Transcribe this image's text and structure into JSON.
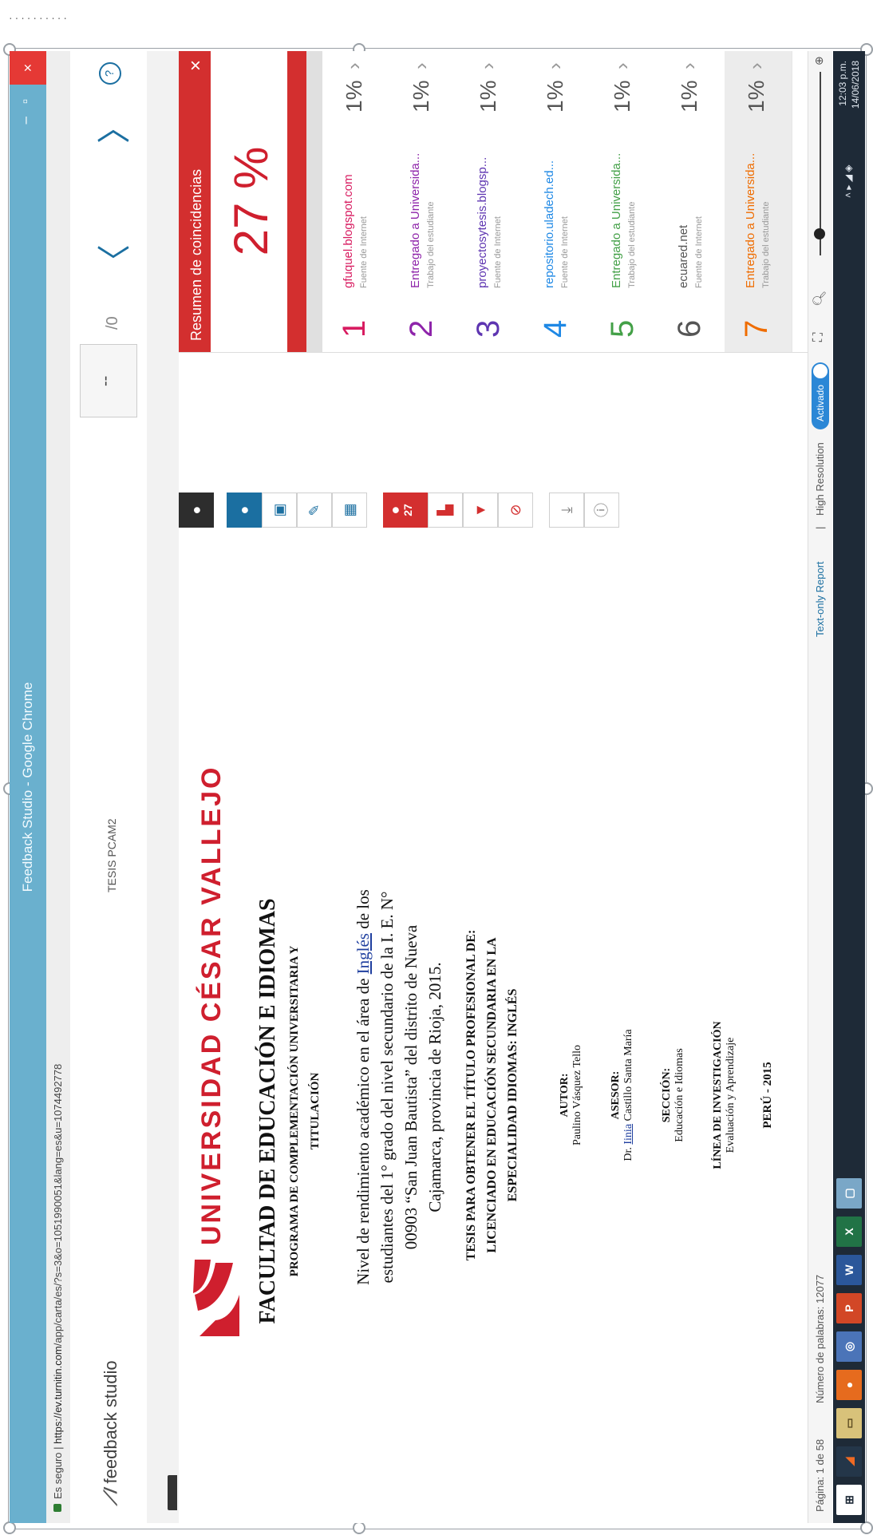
{
  "image_label": "..........",
  "browser": {
    "window_title": "Feedback Studio - Google Chrome",
    "secure_label": "Es seguro",
    "url_host": "https://ev.turnitin.com",
    "url_path": "/app/carta/es/?s=3&o=1051990051&lang=es&u=1074492778"
  },
  "app": {
    "logo_text": "feedback studio",
    "document_title": "TESIS PCAM2",
    "page_field": "--",
    "page_total": "/0",
    "help": "?"
  },
  "document": {
    "university": "UNIVERSIDAD CÉSAR VALLEJO",
    "faculty": "FACULTAD DE EDUCACIÓN E IDIOMAS",
    "program_line1": "PROGRAMA DE COMPLEMENTACIÓN UNIVERSITARIA Y",
    "program_line2": "TITULACIÓN",
    "thesis_line1_pre": "Nivel de rendimiento académico en el área de ",
    "thesis_line1_hl": "Inglés",
    "thesis_line1_post": " de los",
    "thesis_line2": "estudiantes del 1° grado del nivel secundario de la I. E. N°",
    "thesis_line3": "00903 “San Juan Bautista” del distrito de Nueva",
    "thesis_line4": "Cajamarca, provincia de Rioja, 2015.",
    "tesis_line1": "TESIS PARA OBTENER EL TÍTULO PROFESIONAL DE:",
    "tesis_line2": "LICENCIADO EN EDUCACIÓN SECUNDARIA EN LA",
    "tesis_line3": "ESPECIALIDAD IDIOMAS: INGLÉS",
    "autor_label": "AUTOR:",
    "autor": "Paulino Vásquez Tello",
    "asesor_label": "ASESOR:",
    "asesor_pre": "Dr. ",
    "asesor_hl": "Iinia",
    "asesor_post": " Castillo Santa María",
    "seccion_label": "SECCIÓN:",
    "seccion": "Educación e Idiomas",
    "linea_label": "LÍNEA DE INVESTIGACIÓN",
    "linea": "Evaluación y Aprendizaje",
    "peru": "PERÚ - 2015"
  },
  "toolbar": {
    "match_count": "27"
  },
  "panel": {
    "title": "Resumen de coincidencias",
    "close": "×",
    "overall": "27 %",
    "matches": [
      {
        "num": "1",
        "source": "gfuquel.blogspot.com",
        "kind": "Fuente de Internet",
        "pct": "1%",
        "color": "#d81b60"
      },
      {
        "num": "2",
        "source": "Entregado a Universida...",
        "kind": "Trabajo del estudiante",
        "pct": "1%",
        "color": "#8e24aa"
      },
      {
        "num": "3",
        "source": "proyectosytesis.blogsp...",
        "kind": "Fuente de Internet",
        "pct": "1%",
        "color": "#5e35b1"
      },
      {
        "num": "4",
        "source": "repositorio.uladech.ed...",
        "kind": "Fuente de Internet",
        "pct": "1%",
        "color": "#1e88e5"
      },
      {
        "num": "5",
        "source": "Entregado a Universida...",
        "kind": "Trabajo del estudiante",
        "pct": "1%",
        "color": "#43a047"
      },
      {
        "num": "6",
        "source": "ecuared.net",
        "kind": "Fuente de Internet",
        "pct": "1%",
        "color": "#555555"
      },
      {
        "num": "7",
        "source": "Entregado a Universida...",
        "kind": "Trabajo del estudiante",
        "pct": "1%",
        "color": "#ef6c00"
      }
    ]
  },
  "status": {
    "page": "Página: 1 de 58",
    "words": "Número de palabras: 12077",
    "text_only": "Text-only Report",
    "high_res": "High Resolution",
    "toggle": "Activado"
  },
  "taskbar": {
    "time": "12:03 p.m.",
    "date": "14/06/2018"
  },
  "colors": {
    "accent": "#1b6fa1",
    "brand_red": "#d32f2f",
    "titlebar": "#6ab0ce"
  },
  "icons": [
    "windows-start-icon",
    "edge-icon",
    "explorer-icon",
    "firefox-icon",
    "chrome-icon",
    "powerpoint-icon",
    "word-icon",
    "excel-icon",
    "app-icon"
  ]
}
